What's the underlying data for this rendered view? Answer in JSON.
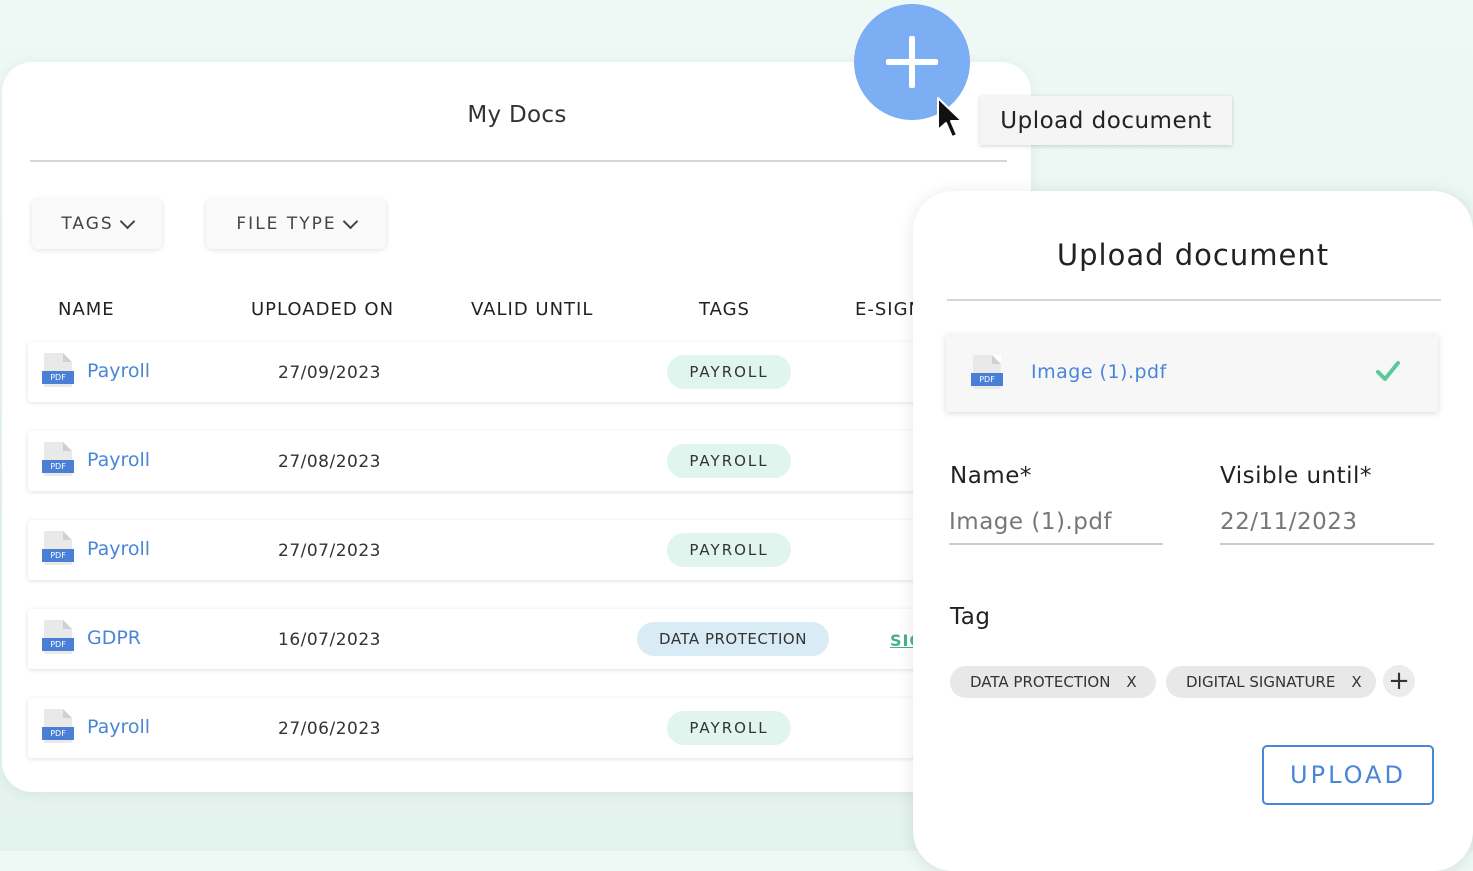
{
  "docs": {
    "title": "My Docs",
    "filters": {
      "tags_label": "TAGS",
      "file_type_label": "FILE TYPE"
    },
    "columns": [
      "NAME",
      "UPLOADED ON",
      "VALID UNTIL",
      "TAGS",
      "E-SIGN"
    ],
    "rows": [
      {
        "icon_label": "PDF",
        "name": "Payroll",
        "uploaded": "27/09/2023",
        "tag": "PAYROLL",
        "sign": ""
      },
      {
        "icon_label": "PDF",
        "name": "Payroll",
        "uploaded": "27/08/2023",
        "tag": "PAYROLL",
        "sign": ""
      },
      {
        "icon_label": "PDF",
        "name": "Payroll",
        "uploaded": "27/07/2023",
        "tag": "PAYROLL",
        "sign": ""
      },
      {
        "icon_label": "PDF",
        "name": "GDPR",
        "uploaded": "16/07/2023",
        "tag": "DATA PROTECTION",
        "sign": "SIGN"
      },
      {
        "icon_label": "PDF",
        "name": "Payroll",
        "uploaded": "27/06/2023",
        "tag": "PAYROLL",
        "sign": ""
      }
    ]
  },
  "tooltip": {
    "text": "Upload document"
  },
  "upload": {
    "title": "Upload document",
    "file": {
      "icon_label": "PDF",
      "name": "Image (1).pdf"
    },
    "name_label": "Name*",
    "name_value": "Image (1).pdf",
    "visible_label": "Visible until*",
    "visible_value": "22/11/2023",
    "tag_label": "Tag",
    "chips": [
      {
        "label": "DATA PROTECTION",
        "remove": "X"
      },
      {
        "label": "DIGITAL SIGNATURE",
        "remove": "X"
      }
    ],
    "add_chip": "+",
    "button": "UPLOAD"
  },
  "colors": {
    "accent_blue": "#4a86d8",
    "fab_blue": "#7baef3",
    "check_green": "#5cc99a",
    "tag_green_bg": "#e0f5ee",
    "tag_blue_bg": "#d9ecf6"
  }
}
